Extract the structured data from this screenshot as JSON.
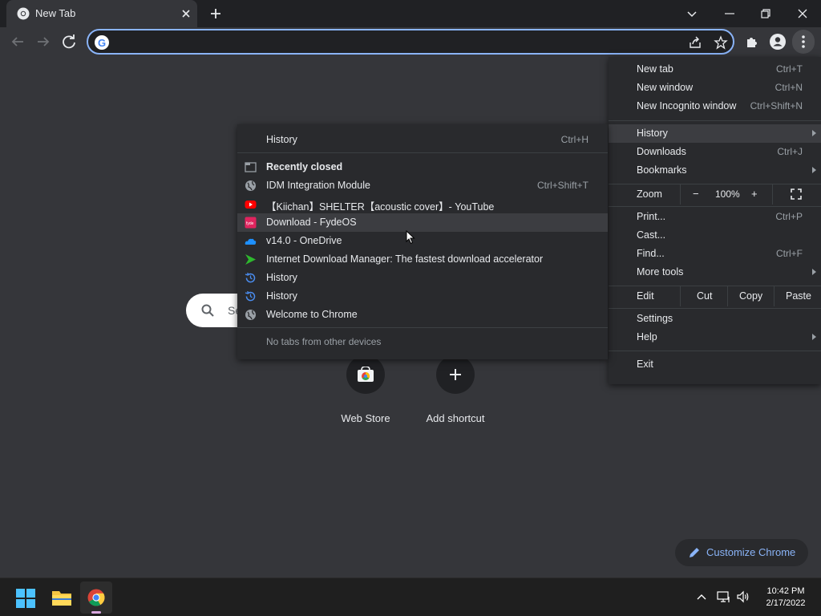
{
  "browser": {
    "tab_title": "New Tab",
    "omnibox_value": "",
    "colors": {
      "accent": "#8ab4f8",
      "bg": "#35363a",
      "menu_bg": "#292a2d"
    }
  },
  "ntp": {
    "search_placeholder": "Se",
    "shortcuts": [
      {
        "label": "Web Store",
        "icon": "web-store-icon"
      },
      {
        "label": "Add shortcut",
        "icon": "plus-icon"
      }
    ],
    "customize_label": "Customize Chrome"
  },
  "main_menu": {
    "new_tab": {
      "label": "New tab",
      "shortcut": "Ctrl+T"
    },
    "new_window": {
      "label": "New window",
      "shortcut": "Ctrl+N"
    },
    "new_incognito": {
      "label": "New Incognito window",
      "shortcut": "Ctrl+Shift+N"
    },
    "history": {
      "label": "History"
    },
    "downloads": {
      "label": "Downloads",
      "shortcut": "Ctrl+J"
    },
    "bookmarks": {
      "label": "Bookmarks"
    },
    "zoom": {
      "label": "Zoom",
      "minus": "−",
      "value": "100%",
      "plus": "+"
    },
    "print": {
      "label": "Print...",
      "shortcut": "Ctrl+P"
    },
    "cast": {
      "label": "Cast..."
    },
    "find": {
      "label": "Find...",
      "shortcut": "Ctrl+F"
    },
    "more_tools": {
      "label": "More tools"
    },
    "edit": {
      "label": "Edit",
      "cut": "Cut",
      "copy": "Copy",
      "paste": "Paste"
    },
    "settings": {
      "label": "Settings"
    },
    "help": {
      "label": "Help"
    },
    "exit": {
      "label": "Exit"
    }
  },
  "history_menu": {
    "history": {
      "label": "History",
      "shortcut": "Ctrl+H"
    },
    "recently_closed": {
      "label": "Recently closed"
    },
    "items": [
      {
        "label": "IDM Integration Module",
        "shortcut": "Ctrl+Shift+T",
        "icon": "globe-icon"
      },
      {
        "label": "【Kiichan】SHELTER【acoustic cover】- YouTube",
        "shortcut": "",
        "icon": "youtube-icon"
      },
      {
        "label": "Download - FydeOS",
        "shortcut": "",
        "icon": "fydeos-icon"
      },
      {
        "label": "v14.0 - OneDrive",
        "shortcut": "",
        "icon": "onedrive-icon"
      },
      {
        "label": "Internet Download Manager: The fastest download accelerator",
        "shortcut": "",
        "icon": "idm-icon"
      },
      {
        "label": "History",
        "shortcut": "",
        "icon": "history-icon"
      },
      {
        "label": "History",
        "shortcut": "",
        "icon": "history-icon"
      },
      {
        "label": "Welcome to Chrome",
        "shortcut": "",
        "icon": "globe-icon"
      }
    ],
    "no_tabs": {
      "label": "No tabs from other devices"
    }
  },
  "taskbar": {
    "time": "10:42 PM",
    "date": "2/17/2022"
  }
}
